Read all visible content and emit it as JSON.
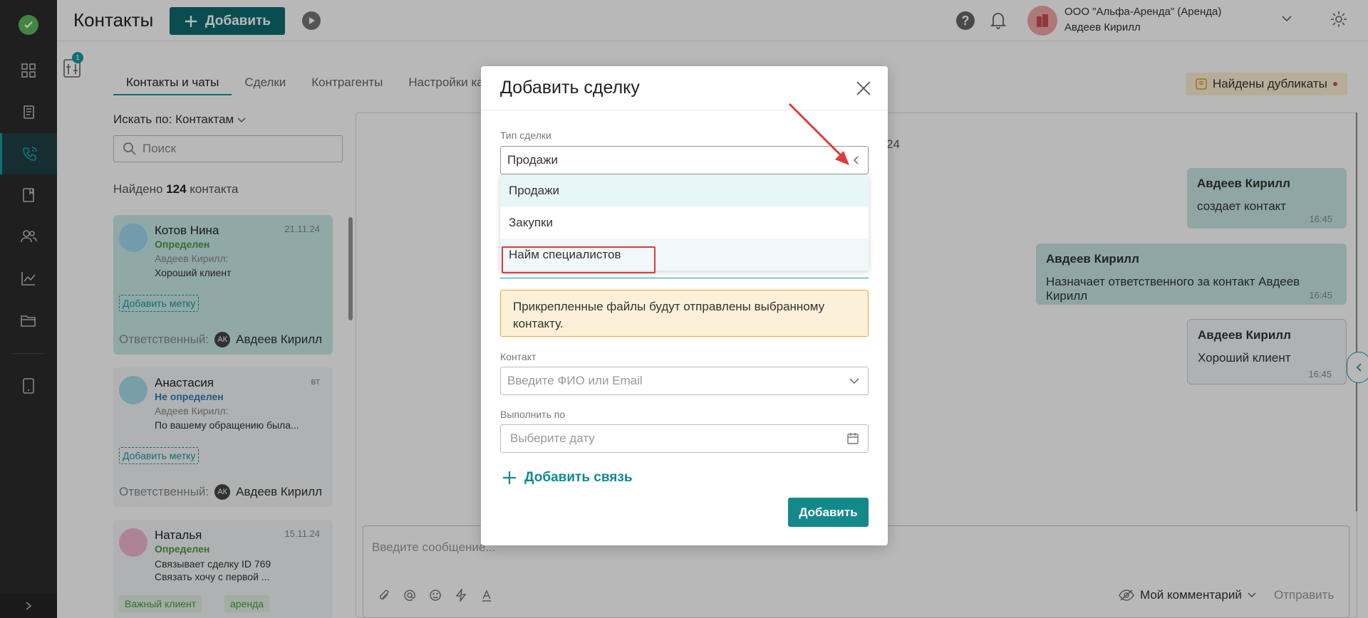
{
  "app": {
    "title": "Контакты",
    "add_label": "Добавить"
  },
  "header": {
    "org_line1": "ООО \"Альфа-Аренда\" (Аренда)",
    "org_line2": "Авдеев Кирилл",
    "filter_count": "1"
  },
  "tabs": [
    {
      "label": "Контакты и чаты"
    },
    {
      "label": "Сделки"
    },
    {
      "label": "Контрагенты"
    },
    {
      "label": "Настройки ка"
    }
  ],
  "duplicates_label": "Найдены дубликаты",
  "search": {
    "by_label": "Искать по: Контактам",
    "placeholder": "Поиск"
  },
  "found": {
    "prefix": "Найдено",
    "count": "124",
    "suffix": "контакта"
  },
  "contacts": [
    {
      "name": "Котов Нина",
      "date": "21.11.24",
      "status": "Определен",
      "author": "Авдеев Кирилл:",
      "message": "Хороший клиент",
      "tag_btn": "Добавить метку",
      "resp_label": "Ответственный:",
      "resp_initials": "АК",
      "resp_name": "Авдеев Кирилл"
    },
    {
      "name": "Анастасия",
      "date": "вт",
      "status": "Не определен",
      "author": "Авдеев Кирилл:",
      "message": "По вашему обращению была...",
      "tag_btn": "Добавить метку",
      "resp_label": "Ответственный:",
      "resp_initials": "АК",
      "resp_name": "Авдеев Кирилл"
    },
    {
      "name": "Наталья",
      "date": "15.11.24",
      "status": "Определен",
      "message_line1": "Связывает сделку ID 769",
      "message_line2": "Связать хочу с первой ...",
      "tags": [
        "Важный клиент",
        "аренда"
      ]
    }
  ],
  "chat": {
    "date_fragment": "24",
    "messages": [
      {
        "author": "Авдеев Кирилл",
        "text": "создает контакт",
        "time": "16:45"
      },
      {
        "author": "Авдеев Кирилл",
        "text": "Назначает ответственного за контакт Авдеев Кирилл",
        "time": "16:45"
      },
      {
        "author": "Авдеев Кирилл",
        "text": "Хороший клиент",
        "time": "16:45"
      }
    ],
    "input_placeholder": "Введите сообщение...",
    "my_comment": "Мой комментарий",
    "send": "Отправить"
  },
  "modal": {
    "title": "Добавить сделку",
    "deal_type_label": "Тип сделки",
    "deal_type_value": "Продажи",
    "options": [
      "Продажи",
      "Закупки",
      "Найм специалистов"
    ],
    "warning": "Прикрепленные файлы будут отправлены выбранному контакту.",
    "contact_label": "Контакт",
    "contact_placeholder": "Введите ФИО или Email",
    "due_label": "Выполнить по",
    "due_placeholder": "Выберите дату",
    "add_link": "Добавить связь",
    "submit": "Добавить"
  },
  "colors": {
    "accent": "#13898c",
    "sidebar": "#2b2b2b",
    "highlight": "#e03a3a"
  }
}
